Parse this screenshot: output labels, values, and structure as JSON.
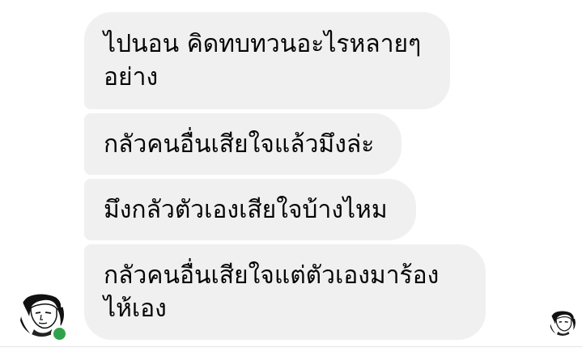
{
  "messages": [
    {
      "text": "ไปนอน คิดทบทวนอะไรหลายๆ\nอย่าง"
    },
    {
      "text": "กลัวคนอื่นเสียใจแล้วมึงล่ะ"
    },
    {
      "text": "มึงกลัวตัวเองเสียใจบ้างไหม"
    },
    {
      "text": "กลัวคนอื่นเสียใจแต่ตัวเองมาร้อง\nไห้เอง"
    }
  ],
  "sender": {
    "avatar_icon": "user-avatar-sketch",
    "online": true,
    "status_color": "#31a24c"
  },
  "read_receipt": {
    "avatar_icon": "seen-avatar-sketch"
  },
  "colors": {
    "bubble_bg": "#f0f0f0",
    "text": "#050505"
  }
}
